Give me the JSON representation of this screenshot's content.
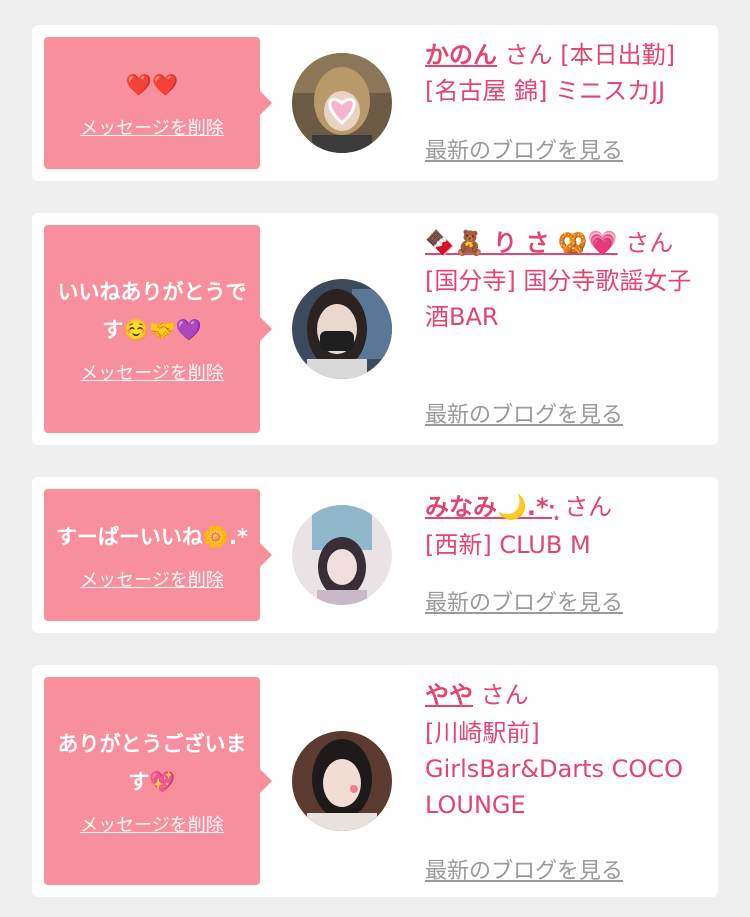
{
  "messages": [
    {
      "message_text": "❤️❤️",
      "delete_label": "メッセージを削除",
      "cast_name": "かのん",
      "suffix": "さん",
      "shop": "[本日出勤][名古屋 錦] ミニスカJJ",
      "blog_link": "最新のブログを見る"
    },
    {
      "message_text": "いいねありがとうです☺️🤝💜",
      "delete_label": "メッセージを削除",
      "cast_name": "🍫🧸 り さ 🥨💗",
      "suffix": "さん",
      "shop": "[国分寺] 国分寺歌謡女子酒BAR",
      "blog_link": "最新のブログを見る"
    },
    {
      "message_text": "すーぱーいいね🌼.*",
      "delete_label": "メッセージを削除",
      "cast_name": "みなみ🌙.*·̩͙",
      "suffix": "さん",
      "shop": "[西新] CLUB M",
      "blog_link": "最新のブログを見る"
    },
    {
      "message_text": "ありがとうございます💖",
      "delete_label": "メッセージを削除",
      "cast_name": "やや",
      "suffix": "さん",
      "shop": "[川崎駅前] GirlsBar&Darts COCO LOUNGE",
      "blog_link": "最新のブログを見る"
    }
  ],
  "colors": {
    "background": "#efefef",
    "card": "#ffffff",
    "bubble": "#f7909c",
    "accent_text": "#e2456f",
    "link_gray": "#9a9a9a"
  },
  "icons": [
    "avatar-photo"
  ]
}
